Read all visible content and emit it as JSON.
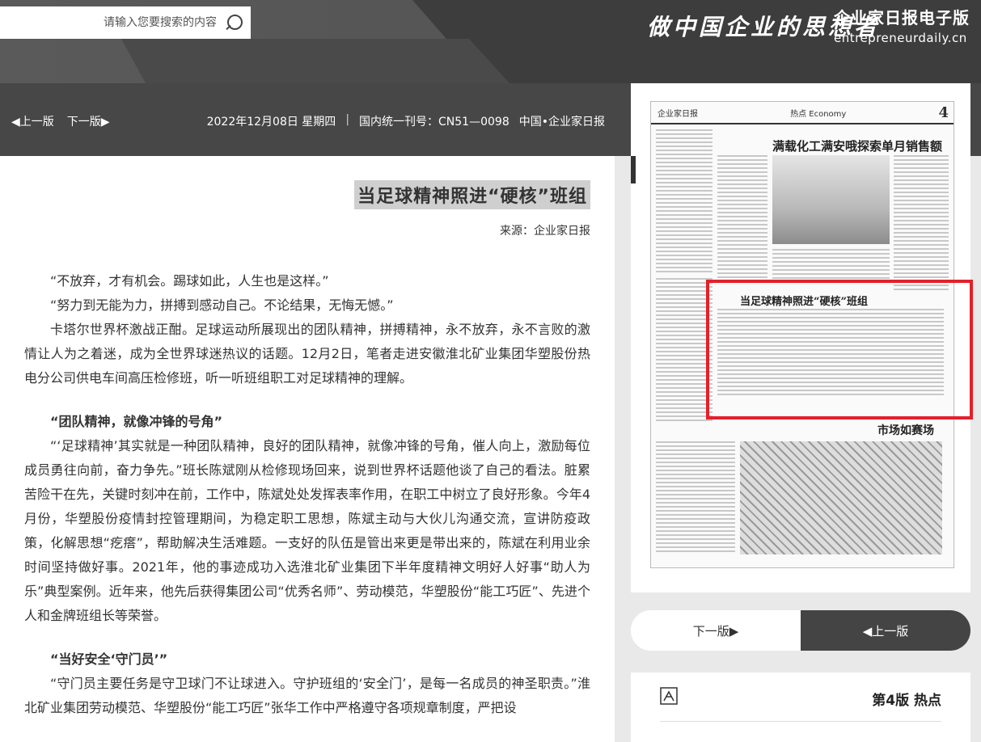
{
  "header": {
    "search_placeholder": "请输入您要搜索的内容",
    "slogan": "做中国企业的思想者",
    "brand_cn": "企业家日报电子版",
    "brand_en": "entrepreneurdaily.cn"
  },
  "infobar": {
    "prev_label": "◀上一版",
    "next_label": "下一版▶",
    "date": "2022年12月08日 星期四",
    "separator": "|",
    "issn": "国内统一刊号：CN51—0098",
    "publisher": "中国•企业家日报"
  },
  "article": {
    "title": "当足球精神照进“硬核”班组",
    "source": "来源：企业家日报",
    "paragraphs": [
      "“不放弃，才有机会。踢球如此，人生也是这样。”",
      "“努力到无能为力，拼搏到感动自己。不论结果，无悔无憾。”",
      "卡塔尔世界杯激战正酣。足球运动所展现出的团队精神，拼搏精神，永不放弃，永不言败的激情让人为之着迷，成为全世界球迷热议的话题。12月2日，笔者走进安徽淮北矿业集团华塑股份热电分公司供电车间高压检修班，听一听班组职工对足球精神的理解。"
    ],
    "section1_title": "“团队精神，就像冲锋的号角”",
    "section1_paragraphs": [
      "“‘足球精神’其实就是一种团队精神，良好的团队精神，就像冲锋的号角，催人向上，激励每位成员勇往向前，奋力争先。”班长陈斌刚从检修现场回来，说到世界杯话题他谈了自己的看法。脏累苦险干在先，关键时刻冲在前，工作中，陈斌处处发挥表率作用，在职工中树立了良好形象。今年4月份，华塑股份疫情封控管理期间，为稳定职工思想，陈斌主动与大伙儿沟通交流，宣讲防疫政策，化解思想“疙瘩”，帮助解决生活难题。一支好的队伍是管出来更是带出来的，陈斌在利用业余时间坚持做好事。2021年，他的事迹成功入选淮北矿业集团下半年度精神文明好人好事“助人为乐”典型案例。近年来，他先后获得集团公司“优秀名师”、劳动模范，华塑股份“能工巧匠”、先进个人和金牌班组长等荣誉。"
    ],
    "section2_title": "“当好安全‘守门员’”",
    "section2_paragraphs": [
      "“守门员主要任务是守卫球门不让球进入。守护班组的‘安全门’，是每一名成员的神圣职责。”淮北矿业集团劳动模范、华塑股份“能工巧匠”张华工作中严格遵守各项规章制度，严把设"
    ]
  },
  "page_thumb": {
    "masthead": "企业家日报",
    "section": "热点 Economy",
    "page_num": "4",
    "headline_main": "满载化工满安哦探索单月销售额首破亿",
    "headline_highlight": "当足球精神照进“硬核”班组",
    "headline_bottom": "市场如赛场"
  },
  "pager": {
    "next_label": "下一版▶",
    "prev_label": "◀上一版"
  },
  "section_list": {
    "current": "第4版 热点"
  }
}
